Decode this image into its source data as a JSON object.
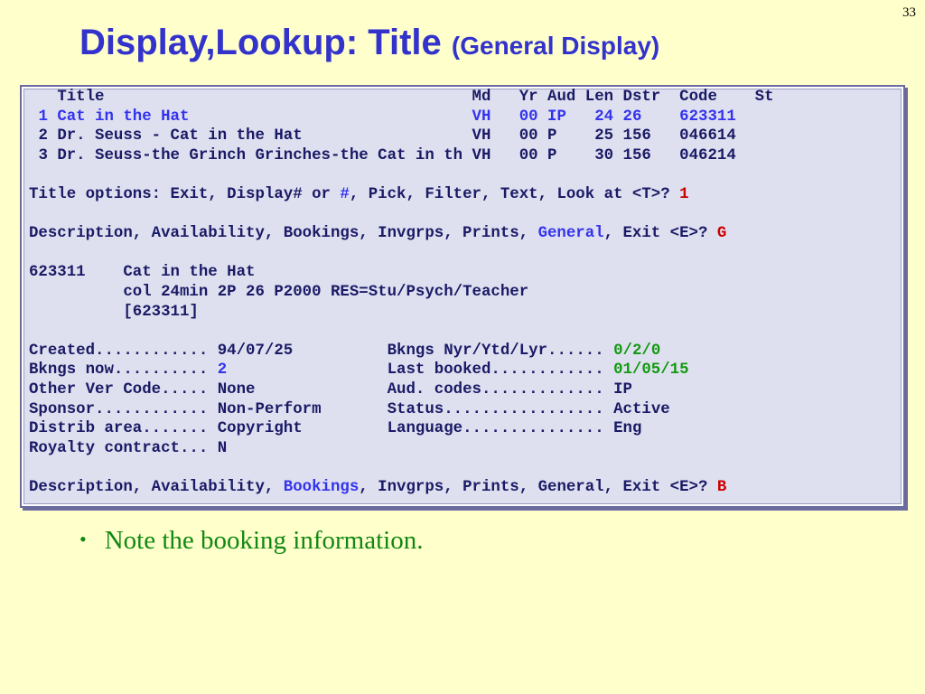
{
  "slide": {
    "page_number": "33",
    "title_main": "Display,Lookup: Title",
    "title_sub": "(General Display)"
  },
  "terminal": {
    "header": {
      "title": "Title",
      "md": "Md",
      "yr": "Yr",
      "aud": "Aud",
      "len": "Len",
      "dstr": "Dstr",
      "code": "Code",
      "st": "St"
    },
    "rows": [
      {
        "num": "1",
        "title": "Cat in the Hat",
        "md": "VH",
        "yr": "00",
        "aud": "IP",
        "len": "24",
        "dstr": "26",
        "code": "623311"
      },
      {
        "num": "2",
        "title": "Dr. Seuss - Cat in the Hat",
        "md": "VH",
        "yr": "00",
        "aud": "P",
        "len": "25",
        "dstr": "156",
        "code": "046614"
      },
      {
        "num": "3",
        "title": "Dr. Seuss-the Grinch Grinches-the Cat in th",
        "md": "VH",
        "yr": "00",
        "aud": "P",
        "len": "30",
        "dstr": "156",
        "code": "046214"
      }
    ],
    "prompt1": {
      "text_a": "Title options: Exit, Display# or ",
      "hash": "#",
      "text_b": ", Pick, Filter, Text, Look at <T>? ",
      "answer": "1"
    },
    "prompt2": {
      "text_a": "Description, Availability, Bookings, Invgrps, Prints, ",
      "highlight": "General",
      "text_b": ", Exit <E>? ",
      "answer": "G"
    },
    "detail": {
      "code": "623311",
      "title": "Cat in the Hat",
      "desc": "col 24min 2P 26 P2000 RES=Stu/Psych/Teacher",
      "ref": "[623311]"
    },
    "fields_left": [
      {
        "label": "Created............",
        "value": "94/07/25"
      },
      {
        "label": "Bkngs now..........",
        "value": "2"
      },
      {
        "label": "Other Ver Code.....",
        "value": "None"
      },
      {
        "label": "Sponsor............",
        "value": "Non-Perform"
      },
      {
        "label": "Distrib area.......",
        "value": "Copyright"
      },
      {
        "label": "Royalty contract...",
        "value": "N"
      }
    ],
    "fields_right": [
      {
        "label": "Bkngs Nyr/Ytd/Lyr......",
        "value": "0/2/0"
      },
      {
        "label": "Last booked............",
        "value": "01/05/15"
      },
      {
        "label": "Aud. codes.............",
        "value": "IP"
      },
      {
        "label": "Status.................",
        "value": "Active"
      },
      {
        "label": "Language...............",
        "value": "Eng"
      }
    ],
    "prompt3": {
      "text_a": "Description, Availability, ",
      "highlight": "Bookings",
      "text_b": ", Invgrps, Prints, General, Exit <E>? ",
      "answer": "B"
    }
  },
  "bullet": {
    "text": "Note the booking information."
  },
  "colors": {
    "background": "#ffffcc",
    "title": "#3333cc",
    "terminal_text": "#1a1a66",
    "highlight_blue": "#3333ee",
    "highlight_green": "#119911",
    "answer_red": "#cc0000",
    "bullet_text": "#118811"
  }
}
